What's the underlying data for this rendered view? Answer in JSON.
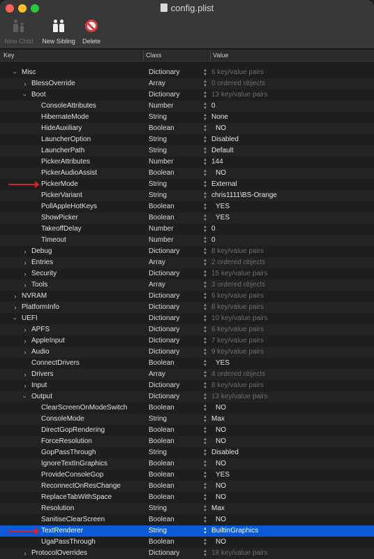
{
  "window": {
    "title": "config.plist"
  },
  "toolbar": {
    "new_child_label": "New Child",
    "new_sibling_label": "New Sibling",
    "delete_label": "Delete"
  },
  "columns": {
    "key": "Key",
    "class": "Class",
    "value": "Value"
  },
  "rows": [
    {
      "key": "Misc",
      "class": "Dictionary",
      "value": "6 key/value pairs",
      "level": 1,
      "disc": "open",
      "muted": true
    },
    {
      "key": "BlessOverride",
      "class": "Array",
      "value": "0 ordered objects",
      "level": 2,
      "disc": "closed",
      "muted": true
    },
    {
      "key": "Boot",
      "class": "Dictionary",
      "value": "13 key/value pairs",
      "level": 2,
      "disc": "open",
      "muted": true
    },
    {
      "key": "ConsoleAttributes",
      "class": "Number",
      "value": "0",
      "level": 3
    },
    {
      "key": "HibernateMode",
      "class": "String",
      "value": "None",
      "level": 3
    },
    {
      "key": "HideAuxiliary",
      "class": "Boolean",
      "value": "NO",
      "level": 3,
      "bool": true
    },
    {
      "key": "LauncherOption",
      "class": "String",
      "value": "Disabled",
      "level": 3
    },
    {
      "key": "LauncherPath",
      "class": "String",
      "value": "Default",
      "level": 3
    },
    {
      "key": "PickerAttributes",
      "class": "Number",
      "value": "144",
      "level": 3
    },
    {
      "key": "PickerAudioAssist",
      "class": "Boolean",
      "value": "NO",
      "level": 3,
      "bool": true
    },
    {
      "key": "PickerMode",
      "class": "String",
      "value": "External",
      "level": 3,
      "arrow": true
    },
    {
      "key": "PickerVariant",
      "class": "String",
      "value": "chris1111\\BS-Orange",
      "level": 3
    },
    {
      "key": "PollAppleHotKeys",
      "class": "Boolean",
      "value": "YES",
      "level": 3,
      "bool": true
    },
    {
      "key": "ShowPicker",
      "class": "Boolean",
      "value": "YES",
      "level": 3,
      "bool": true
    },
    {
      "key": "TakeoffDelay",
      "class": "Number",
      "value": "0",
      "level": 3
    },
    {
      "key": "Timeout",
      "class": "Number",
      "value": "0",
      "level": 3
    },
    {
      "key": "Debug",
      "class": "Dictionary",
      "value": "8 key/value pairs",
      "level": 2,
      "disc": "closed",
      "muted": true
    },
    {
      "key": "Entries",
      "class": "Array",
      "value": "2 ordered objects",
      "level": 2,
      "disc": "closed",
      "muted": true
    },
    {
      "key": "Security",
      "class": "Dictionary",
      "value": "15 key/value pairs",
      "level": 2,
      "disc": "closed",
      "muted": true
    },
    {
      "key": "Tools",
      "class": "Array",
      "value": "3 ordered objects",
      "level": 2,
      "disc": "closed",
      "muted": true
    },
    {
      "key": "NVRAM",
      "class": "Dictionary",
      "value": "6 key/value pairs",
      "level": 1,
      "disc": "closed",
      "muted": true
    },
    {
      "key": "PlatformInfo",
      "class": "Dictionary",
      "value": "8 key/value pairs",
      "level": 1,
      "disc": "closed",
      "muted": true
    },
    {
      "key": "UEFI",
      "class": "Dictionary",
      "value": "10 key/value pairs",
      "level": 1,
      "disc": "open",
      "muted": true
    },
    {
      "key": "APFS",
      "class": "Dictionary",
      "value": "6 key/value pairs",
      "level": 2,
      "disc": "closed",
      "muted": true
    },
    {
      "key": "AppleInput",
      "class": "Dictionary",
      "value": "7 key/value pairs",
      "level": 2,
      "disc": "closed",
      "muted": true
    },
    {
      "key": "Audio",
      "class": "Dictionary",
      "value": "9 key/value pairs",
      "level": 2,
      "disc": "closed",
      "muted": true
    },
    {
      "key": "ConnectDrivers",
      "class": "Boolean",
      "value": "YES",
      "level": 2,
      "bool": true
    },
    {
      "key": "Drivers",
      "class": "Array",
      "value": "4 ordered objects",
      "level": 2,
      "disc": "closed",
      "muted": true
    },
    {
      "key": "Input",
      "class": "Dictionary",
      "value": "8 key/value pairs",
      "level": 2,
      "disc": "closed",
      "muted": true
    },
    {
      "key": "Output",
      "class": "Dictionary",
      "value": "13 key/value pairs",
      "level": 2,
      "disc": "open",
      "muted": true
    },
    {
      "key": "ClearScreenOnModeSwitch",
      "class": "Boolean",
      "value": "NO",
      "level": 3,
      "bool": true
    },
    {
      "key": "ConsoleMode",
      "class": "String",
      "value": "Max",
      "level": 3
    },
    {
      "key": "DirectGopRendering",
      "class": "Boolean",
      "value": "NO",
      "level": 3,
      "bool": true
    },
    {
      "key": "ForceResolution",
      "class": "Boolean",
      "value": "NO",
      "level": 3,
      "bool": true
    },
    {
      "key": "GopPassThrough",
      "class": "String",
      "value": "Disabled",
      "level": 3
    },
    {
      "key": "IgnoreTextInGraphics",
      "class": "Boolean",
      "value": "NO",
      "level": 3,
      "bool": true
    },
    {
      "key": "ProvideConsoleGop",
      "class": "Boolean",
      "value": "YES",
      "level": 3,
      "bool": true
    },
    {
      "key": "ReconnectOnResChange",
      "class": "Boolean",
      "value": "NO",
      "level": 3,
      "bool": true
    },
    {
      "key": "ReplaceTabWithSpace",
      "class": "Boolean",
      "value": "NO",
      "level": 3,
      "bool": true
    },
    {
      "key": "Resolution",
      "class": "String",
      "value": "Max",
      "level": 3
    },
    {
      "key": "SanitiseClearScreen",
      "class": "Boolean",
      "value": "NO",
      "level": 3,
      "bool": true
    },
    {
      "key": "TextRenderer",
      "class": "String",
      "value": "BuiltinGraphics",
      "level": 3,
      "selected": true,
      "arrow": true
    },
    {
      "key": "UgaPassThrough",
      "class": "Boolean",
      "value": "NO",
      "level": 3,
      "bool": true
    },
    {
      "key": "ProtocolOverrides",
      "class": "Dictionary",
      "value": "18 key/value pairs",
      "level": 2,
      "disc": "closed",
      "muted": true
    }
  ]
}
